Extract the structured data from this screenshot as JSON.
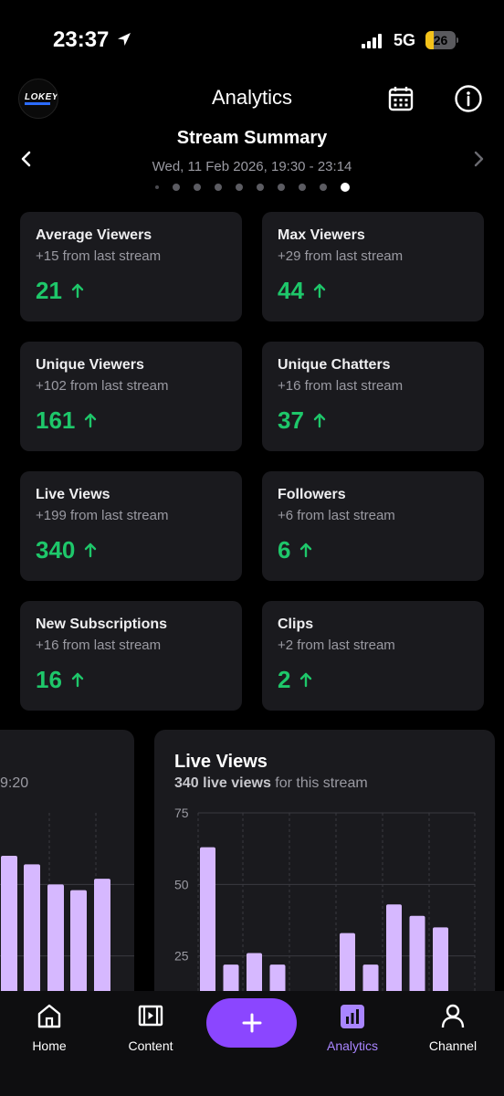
{
  "status": {
    "time": "23:37",
    "network": "5G",
    "battery": "26",
    "battery_level": 0.26
  },
  "header": {
    "title": "Analytics",
    "avatar_text": "LOKEY"
  },
  "summary": {
    "title": "Stream Summary",
    "date": "Wed, 11 Feb 2026, 19:30 - 23:14",
    "page_count": 10,
    "active_index": 9
  },
  "cards": [
    {
      "title": "Average Viewers",
      "sub": "+15 from last stream",
      "value": "21"
    },
    {
      "title": "Max Viewers",
      "sub": "+29 from last stream",
      "value": "44"
    },
    {
      "title": "Unique Viewers",
      "sub": "+102 from last stream",
      "value": "161"
    },
    {
      "title": "Unique Chatters",
      "sub": "+16 from last stream",
      "value": "37"
    },
    {
      "title": "Live Views",
      "sub": "+199 from last stream",
      "value": "340"
    },
    {
      "title": "Followers",
      "sub": "+6 from last stream",
      "value": "6"
    },
    {
      "title": "New Subscriptions",
      "sub": "+16 from last stream",
      "value": "16"
    },
    {
      "title": "Clips",
      "sub": "+2 from last stream",
      "value": "2"
    }
  ],
  "left_chart": {
    "partial_text": "9:20"
  },
  "live_chart": {
    "title": "Live Views",
    "sub_bold": "340 live views",
    "sub_rest": " for this stream"
  },
  "chart_data": [
    {
      "type": "bar",
      "title": "Live Views",
      "ylim": [
        0,
        75
      ],
      "yticks": [
        25,
        50,
        75
      ],
      "grid": true,
      "values": [
        63,
        22,
        26,
        22,
        0,
        0,
        33,
        22,
        43,
        39,
        35
      ],
      "color": "#d6b8ff"
    },
    {
      "type": "bar",
      "title": "",
      "ylim": [
        0,
        75
      ],
      "grid": true,
      "values": [
        60,
        57,
        50,
        48,
        52
      ],
      "color": "#d6b8ff"
    }
  ],
  "tabs": [
    {
      "label": "Home",
      "icon": "home-icon"
    },
    {
      "label": "Content",
      "icon": "content-icon"
    },
    {
      "label": "Analytics",
      "icon": "analytics-icon",
      "active": true
    },
    {
      "label": "Channel",
      "icon": "user-icon"
    }
  ],
  "colors": {
    "accent": "#8b46ff",
    "positive": "#1ec76a",
    "bar": "#d6b8ff",
    "card": "#1a1a1e"
  }
}
